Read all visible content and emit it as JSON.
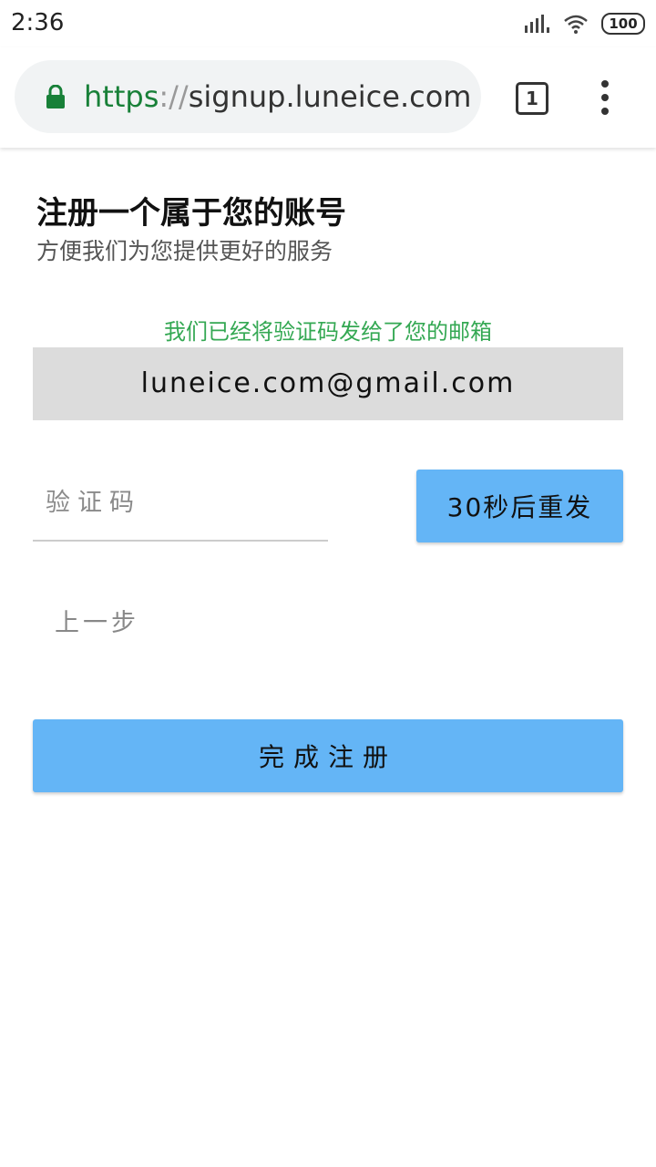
{
  "status_bar": {
    "time": "2:36",
    "battery": "100",
    "icons": [
      "signal-icon",
      "wifi-icon",
      "battery-icon"
    ]
  },
  "browser": {
    "url_scheme": "https",
    "url_separator": "://",
    "url_host": "signup.luneice.com",
    "tab_count": "1",
    "lock_color": "#188038"
  },
  "page": {
    "title": "注册一个属于您的账号",
    "subtitle": "方便我们为您提供更好的服务",
    "notice": "我们已经将验证码发给了您的邮箱",
    "email": "luneice.com@gmail.com",
    "code_placeholder": "验证码",
    "code_value": "",
    "resend_label": "30秒后重发",
    "back_label": "上一步",
    "submit_label": "完成注册"
  },
  "colors": {
    "accent": "#64b5f6",
    "notice": "#34a853",
    "email_bg": "#dcdcdc"
  }
}
